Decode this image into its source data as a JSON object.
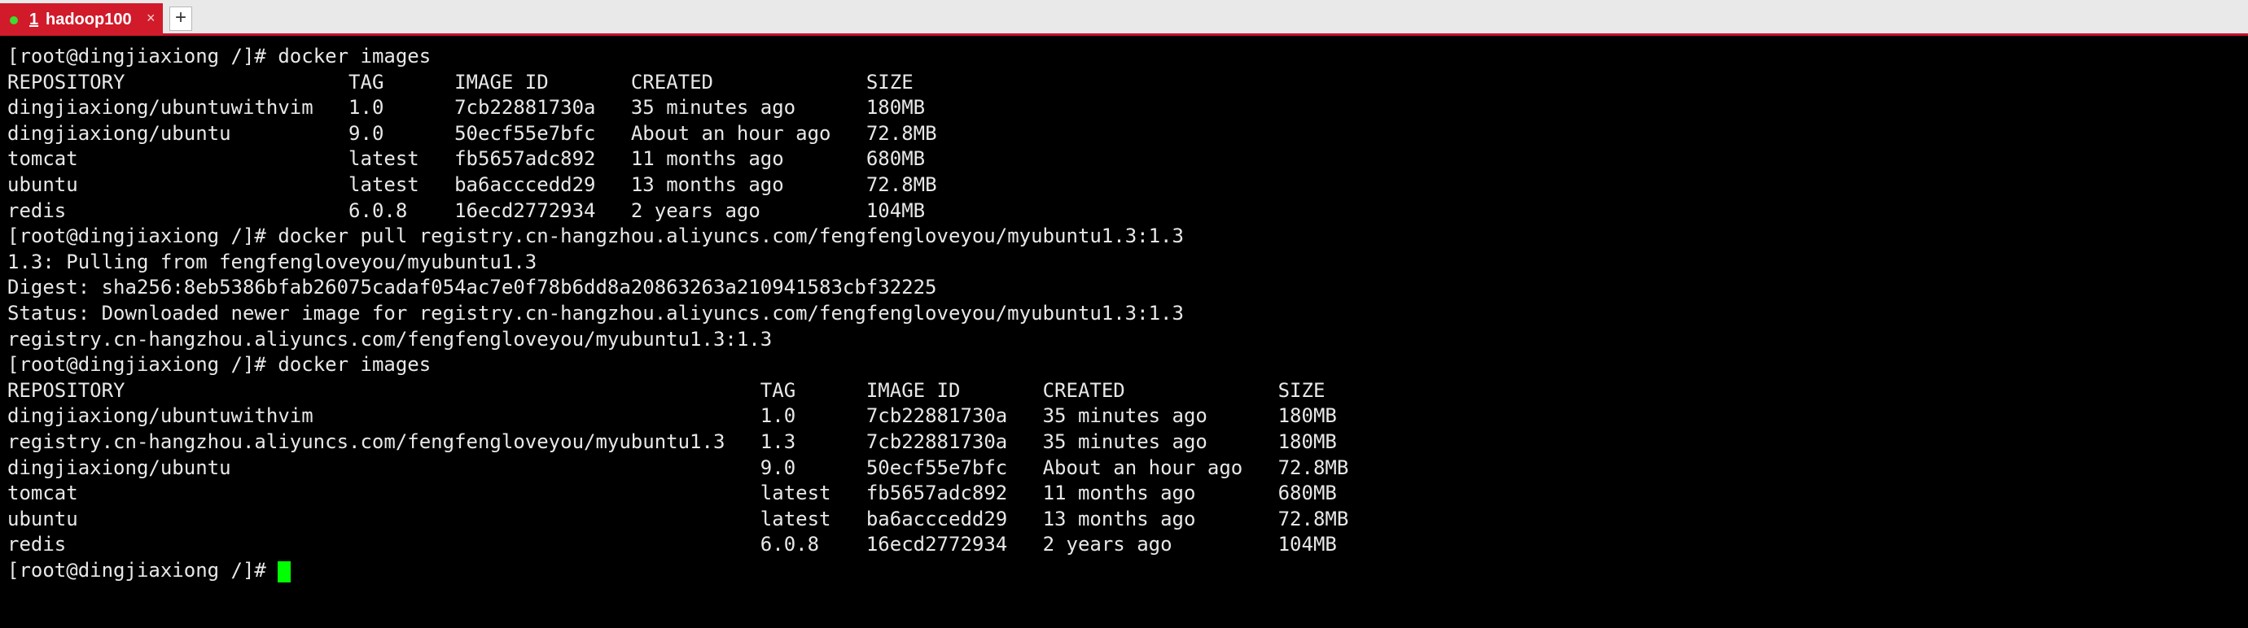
{
  "tabbar": {
    "tab": {
      "number": "1",
      "label": "hadoop100",
      "close": "×"
    },
    "new_tab": "+"
  },
  "colors": {
    "terminal_bg": "#000000",
    "terminal_fg": "#e8e8e8",
    "tab_active": "#d11a2a",
    "status_dot": "#3ddc2f",
    "cursor": "#00ff00"
  },
  "icons": {
    "status": "green-dot-icon",
    "close": "close-icon",
    "add": "plus-icon"
  },
  "terminal": {
    "prompt": "[root@dingjiaxiong /]#",
    "cmd1": "docker images",
    "table1": {
      "headers": [
        "REPOSITORY",
        "TAG",
        "IMAGE ID",
        "CREATED",
        "SIZE"
      ],
      "rows": [
        [
          "dingjiaxiong/ubuntuwithvim",
          "1.0",
          "7cb22881730a",
          "35 minutes ago",
          "180MB"
        ],
        [
          "dingjiaxiong/ubuntu",
          "9.0",
          "50ecf55e7bfc",
          "About an hour ago",
          "72.8MB"
        ],
        [
          "tomcat",
          "latest",
          "fb5657adc892",
          "11 months ago",
          "680MB"
        ],
        [
          "ubuntu",
          "latest",
          "ba6acccedd29",
          "13 months ago",
          "72.8MB"
        ],
        [
          "redis",
          "6.0.8",
          "16ecd2772934",
          "2 years ago",
          "104MB"
        ]
      ]
    },
    "cmd2": "docker pull registry.cn-hangzhou.aliyuncs.com/fengfengloveyou/myubuntu1.3:1.3",
    "pull_output": [
      "1.3: Pulling from fengfengloveyou/myubuntu1.3",
      "Digest: sha256:8eb5386bfab26075cadaf054ac7e0f78b6dd8a20863263a210941583cbf32225",
      "Status: Downloaded newer image for registry.cn-hangzhou.aliyuncs.com/fengfengloveyou/myubuntu1.3:1.3",
      "registry.cn-hangzhou.aliyuncs.com/fengfengloveyou/myubuntu1.3:1.3"
    ],
    "cmd3": "docker images",
    "table2": {
      "headers": [
        "REPOSITORY",
        "TAG",
        "IMAGE ID",
        "CREATED",
        "SIZE"
      ],
      "rows": [
        [
          "dingjiaxiong/ubuntuwithvim",
          "1.0",
          "7cb22881730a",
          "35 minutes ago",
          "180MB"
        ],
        [
          "registry.cn-hangzhou.aliyuncs.com/fengfengloveyou/myubuntu1.3",
          "1.3",
          "7cb22881730a",
          "35 minutes ago",
          "180MB"
        ],
        [
          "dingjiaxiong/ubuntu",
          "9.0",
          "50ecf55e7bfc",
          "About an hour ago",
          "72.8MB"
        ],
        [
          "tomcat",
          "latest",
          "fb5657adc892",
          "11 months ago",
          "680MB"
        ],
        [
          "ubuntu",
          "latest",
          "ba6acccedd29",
          "13 months ago",
          "72.8MB"
        ],
        [
          "redis",
          "6.0.8",
          "16ecd2772934",
          "2 years ago",
          "104MB"
        ]
      ]
    }
  }
}
